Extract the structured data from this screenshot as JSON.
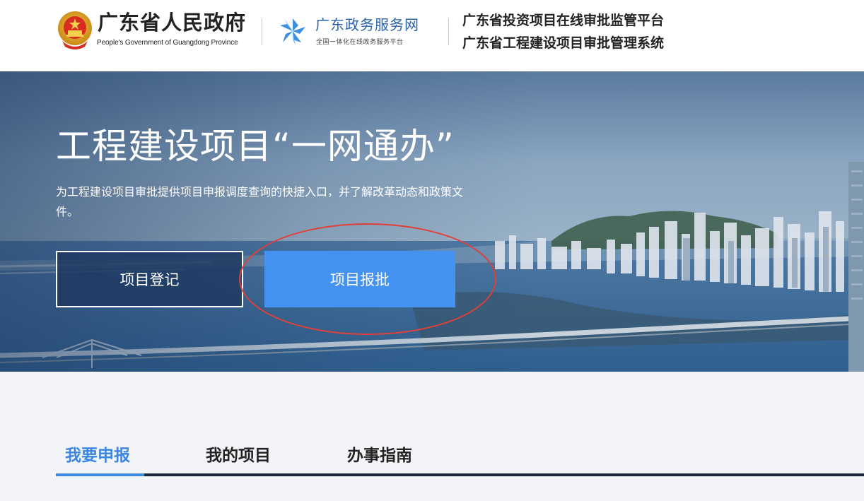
{
  "header": {
    "gov_title": "广东省人民政府",
    "gov_subtitle": "People's Government of Guangdong Province",
    "service_title": "广东政务服务网",
    "service_subtitle": "全国一体化在线政务服务平台",
    "platform_line1": "广东省投资项目在线审批监管平台",
    "platform_line2": "广东省工程建设项目审批管理系统"
  },
  "hero": {
    "title": "工程建设项目“一网通办”",
    "description": "为工程建设项目审批提供项目申报调度查询的快捷入口，并了解改革动态和政策文件。",
    "register_button": "项目登记",
    "approve_button": "项目报批"
  },
  "tabs": {
    "items": [
      {
        "label": "我要申报",
        "active": true
      },
      {
        "label": "我的项目",
        "active": false
      },
      {
        "label": "办事指南",
        "active": false
      }
    ]
  },
  "icons": {
    "gov_emblem": "national-emblem-icon",
    "service_logo": "pinwheel-logo-icon"
  },
  "colors": {
    "accent": "#4493f0",
    "active_tab": "#3d86df",
    "annotation": "#e0403a",
    "service_brand": "#2a62a8"
  }
}
